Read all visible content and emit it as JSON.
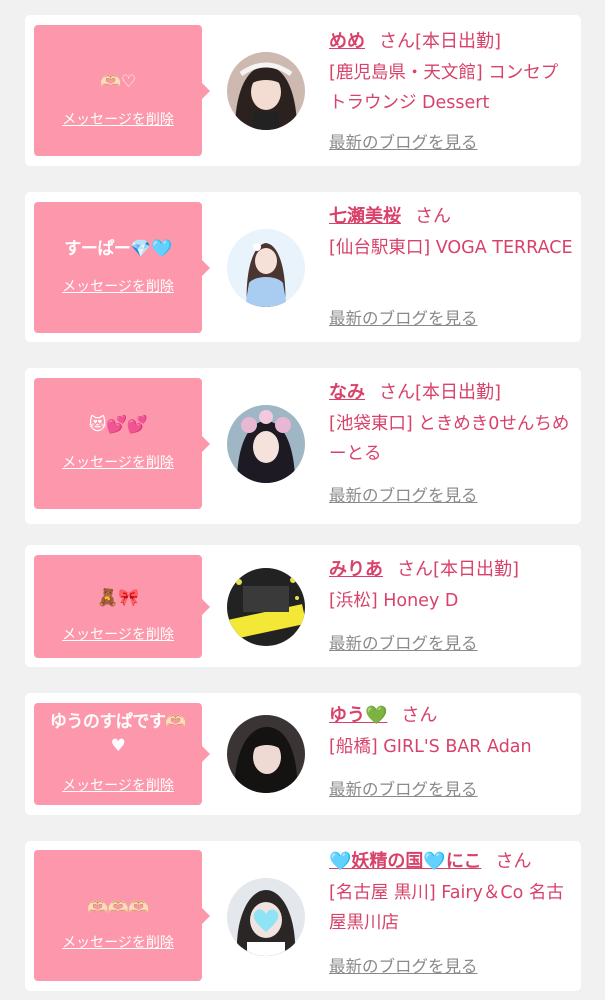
{
  "delete_label": "メッセージを削除",
  "blog_label": "最新のブログを見る",
  "san_label": "さん",
  "colors": {
    "bubble": "#fd98ac",
    "accent_text": "#d8426a",
    "link_gray": "#8a8a8a",
    "card": "#ffffff",
    "background": "#f1f1f1"
  },
  "messages": [
    {
      "message": "🫶🏻♡",
      "name": "めめ",
      "today": "[本日出勤]",
      "shop": "[鹿児島県・天文館] コンセプトラウンジ Dessert"
    },
    {
      "message": "すーぱー💎🩵",
      "name": "七瀬美桜",
      "today": "",
      "shop": "[仙台駅東口] VOGA TERRACE"
    },
    {
      "message": "😻💕💕",
      "name": "なみ",
      "today": "[本日出勤]",
      "shop": "[池袋東口] ときめき0せんちめーとる"
    },
    {
      "message": "🧸🎀",
      "name": "みりあ",
      "today": "[本日出勤]",
      "shop": "[浜松] Honey D"
    },
    {
      "message": "ゆうのすぱです🫶🏻\n♥",
      "name": "ゆう💚",
      "today": "",
      "shop": "[船橋] GIRL'S BAR Adan"
    },
    {
      "message": "🫶🏻🫶🏻🫶🏻",
      "name": "🩵妖精の国🩵にこ",
      "today": "",
      "shop": "[名古屋 黒川] Fairy＆Co 名古屋黒川店"
    }
  ]
}
